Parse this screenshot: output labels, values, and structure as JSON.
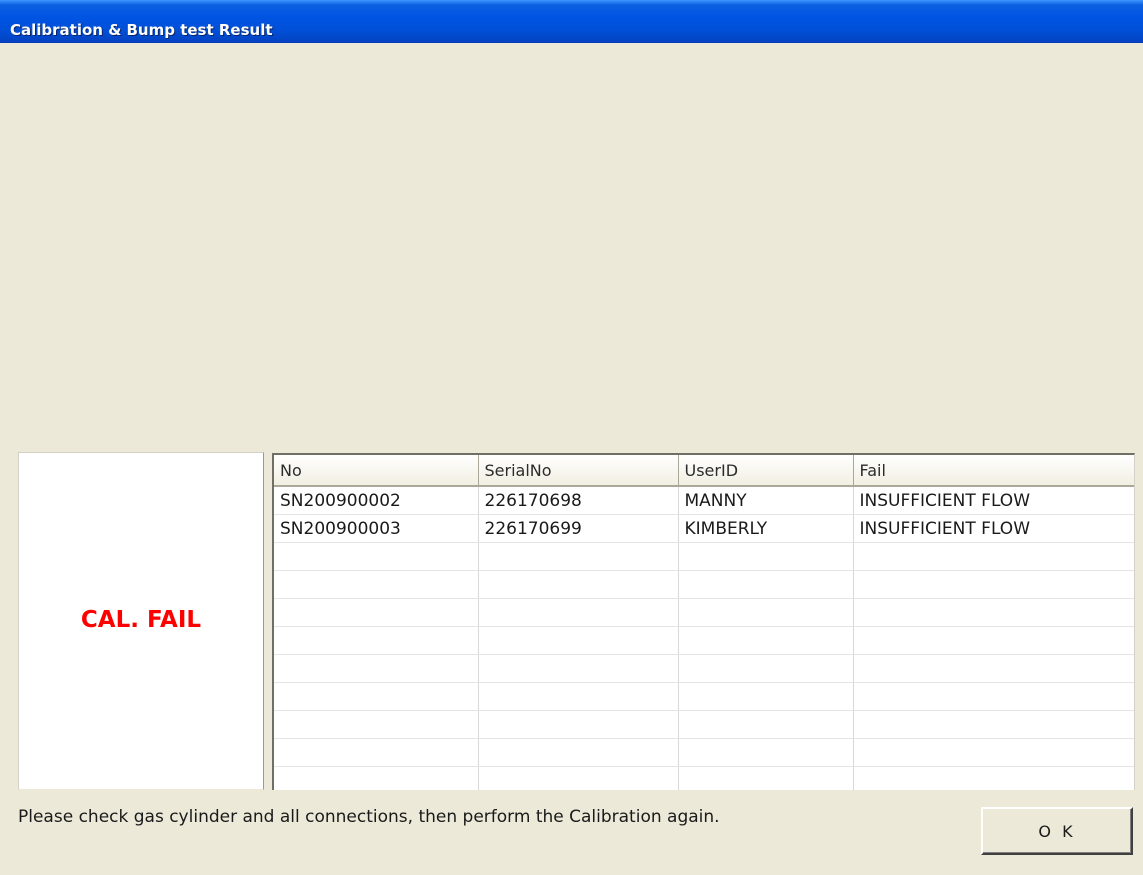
{
  "window": {
    "title": "Calibration & Bump test Result"
  },
  "status": {
    "text": "CAL. FAIL",
    "color": "#ff0000"
  },
  "grid": {
    "columns": [
      "No",
      "SerialNo",
      "UserID",
      "Fail"
    ],
    "rows": [
      [
        "SN200900002",
        "226170698",
        "MANNY",
        "INSUFFICIENT FLOW"
      ],
      [
        "SN200900003",
        "226170699",
        "KIMBERLY",
        "INSUFFICIENT FLOW"
      ]
    ]
  },
  "message": "Please check gas cylinder and all connections, then perform the Calibration again.",
  "ok_button": {
    "label": "O K"
  }
}
